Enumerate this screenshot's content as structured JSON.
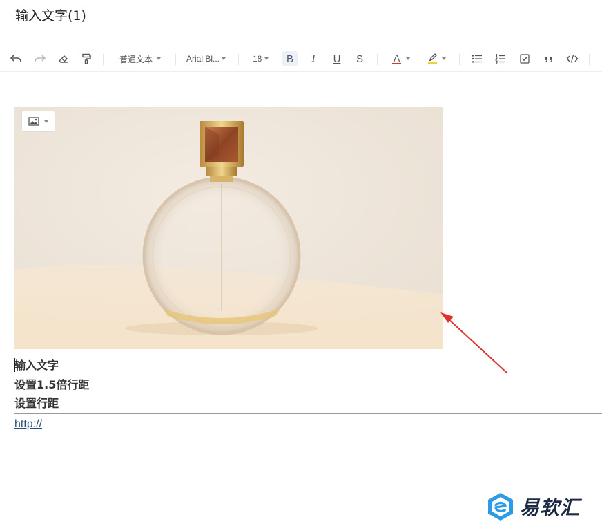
{
  "document": {
    "title": "输入文字(1)"
  },
  "toolbar": {
    "undo_icon": "undo-icon",
    "redo_icon": "redo-icon",
    "clear_format_icon": "eraser-icon",
    "format_painter_icon": "format-painter-icon",
    "paragraph_style": "普通文本",
    "font_family": "Arial Bl...",
    "font_size": "18",
    "bold_label": "B",
    "italic_label": "I",
    "underline_label": "U",
    "strike_label": "S",
    "font_color_label": "A",
    "font_color": "#d9342b",
    "highlight_color": "#f2d03b",
    "bulleted_list_icon": "bulleted-list-icon",
    "numbered_list_icon": "numbered-list-icon",
    "checkbox_icon": "checkbox-icon",
    "quote_icon": "quote-icon",
    "code_icon": "code-icon"
  },
  "image_tool": {
    "icon": "image-icon"
  },
  "content": {
    "lines": [
      "输入文字",
      "设置1.5倍行距",
      "设置行距"
    ],
    "link_text": "http://"
  },
  "annotation": {
    "arrow_color": "#e0332b"
  },
  "watermark": {
    "text": "易软汇"
  }
}
